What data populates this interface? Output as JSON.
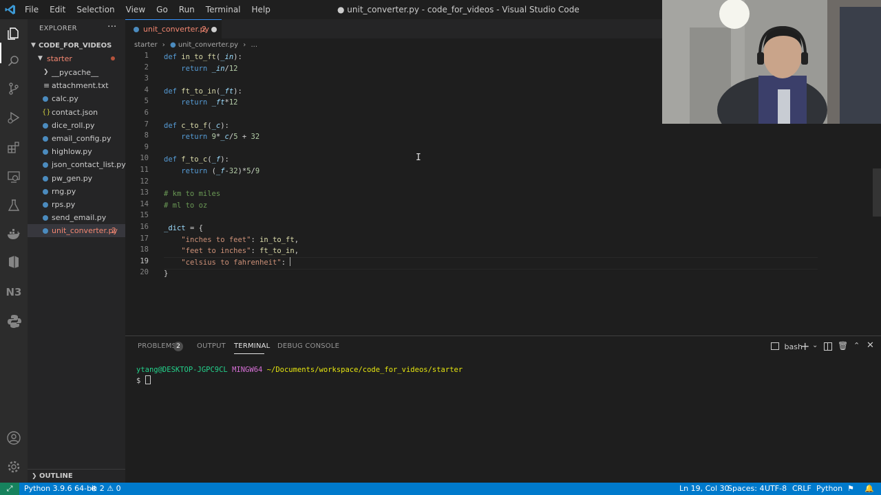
{
  "menu": [
    "File",
    "Edit",
    "Selection",
    "View",
    "Go",
    "Run",
    "Terminal",
    "Help"
  ],
  "window_title": "● unit_converter.py - code_for_videos - Visual Studio Code",
  "sidebar": {
    "header": "EXPLORER",
    "more": "···",
    "root": "CODE_FOR_VIDEOS",
    "folder": "starter",
    "items": [
      {
        "label": "__pycache__",
        "icon": "chevron-right-icon"
      },
      {
        "label": "attachment.txt",
        "icon": "text-file-icon"
      },
      {
        "label": "calc.py",
        "icon": "python-file-icon"
      },
      {
        "label": "contact.json",
        "icon": "json-file-icon"
      },
      {
        "label": "dice_roll.py",
        "icon": "python-file-icon"
      },
      {
        "label": "email_config.py",
        "icon": "python-file-icon"
      },
      {
        "label": "highlow.py",
        "icon": "python-file-icon"
      },
      {
        "label": "json_contact_list.py",
        "icon": "python-file-icon"
      },
      {
        "label": "pw_gen.py",
        "icon": "python-file-icon"
      },
      {
        "label": "rng.py",
        "icon": "python-file-icon"
      },
      {
        "label": "rps.py",
        "icon": "python-file-icon"
      },
      {
        "label": "send_email.py",
        "icon": "python-file-icon"
      },
      {
        "label": "unit_converter.py",
        "icon": "python-file-icon",
        "badge": "2"
      }
    ],
    "outline": "OUTLINE"
  },
  "tab": {
    "label": "unit_converter.py",
    "badge": "2"
  },
  "breadcrumb": {
    "folder": "starter",
    "file": "unit_converter.py",
    "rest": "..."
  },
  "code_lines": [
    "def in_to_ft(_in):",
    "    return _in/12",
    "",
    "def ft_to_in(_ft):",
    "    return _ft*12",
    "",
    "def c_to_f(_c):",
    "    return 9*_c/5 + 32",
    "",
    "def f_to_c(_f):",
    "    return (_f-32)*5/9",
    "",
    "# km to miles",
    "# ml to oz",
    "",
    "_dict = {",
    "    \"inches to feet\": in_to_ft,",
    "    \"feet to inches\": ft_to_in,",
    "    \"celsius to fahrenheit\": ",
    "}"
  ],
  "current_line": 19,
  "panel": {
    "tabs": [
      "PROBLEMS",
      "OUTPUT",
      "TERMINAL",
      "DEBUG CONSOLE"
    ],
    "problems_count": "2",
    "active_tab": "TERMINAL",
    "shell": "bash",
    "terminal": {
      "user": "ytang@DESKTOP-JGPC9CL",
      "host": "MINGW64",
      "path": "~/Documents/workspace/code_for_videos/starter",
      "prompt": "$"
    }
  },
  "status": {
    "python": "Python 3.9.6 64-bit",
    "errors": "2",
    "warnings": "0",
    "position": "Ln 19, Col 30",
    "spaces": "Spaces: 4",
    "encoding": "UTF-8",
    "eol": "CRLF",
    "language": "Python"
  },
  "colors": {
    "statusbar": "#007acc",
    "error": "#f48771",
    "keyword": "#569cd6",
    "function": "#dcdcaa",
    "string": "#ce9178"
  }
}
